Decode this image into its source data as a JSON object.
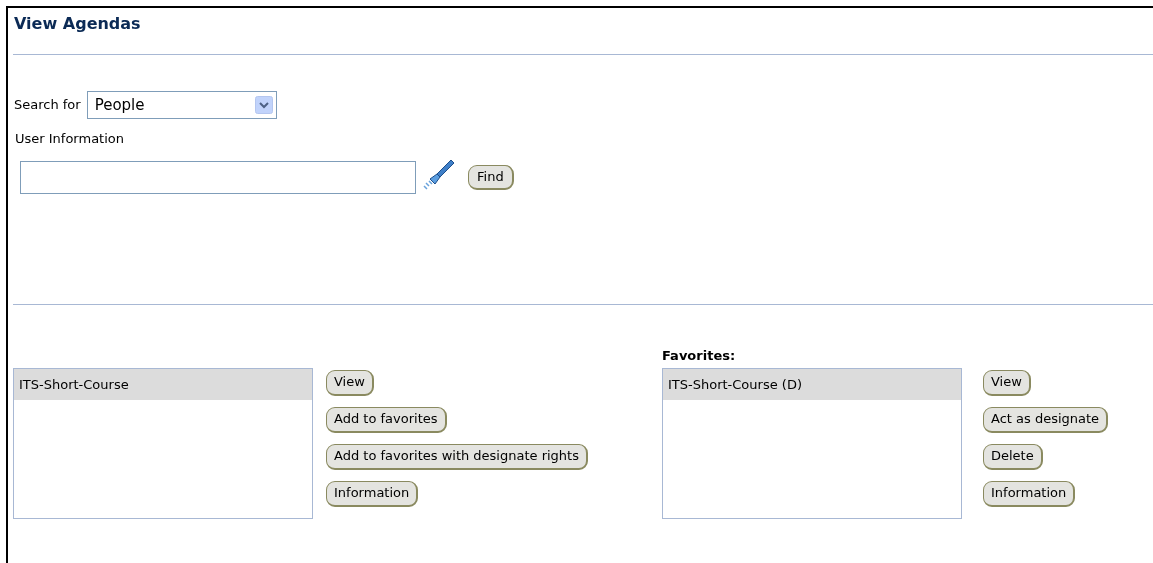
{
  "title": "View Agendas",
  "search": {
    "label": "Search for",
    "value": "People"
  },
  "user_info": {
    "label": "User Information",
    "button": "Find"
  },
  "agendas": {
    "items": [
      {
        "label": "ITS-Short-Course",
        "selected": true
      }
    ],
    "buttons": [
      "View",
      "Add to favorites",
      "Add to favorites with designate rights",
      "Information"
    ]
  },
  "favorites": {
    "label": "Favorites:",
    "items": [
      {
        "label": "ITS-Short-Course (D)",
        "selected": true
      }
    ],
    "buttons": [
      "View",
      "Act as designate",
      "Delete",
      "Information"
    ]
  }
}
